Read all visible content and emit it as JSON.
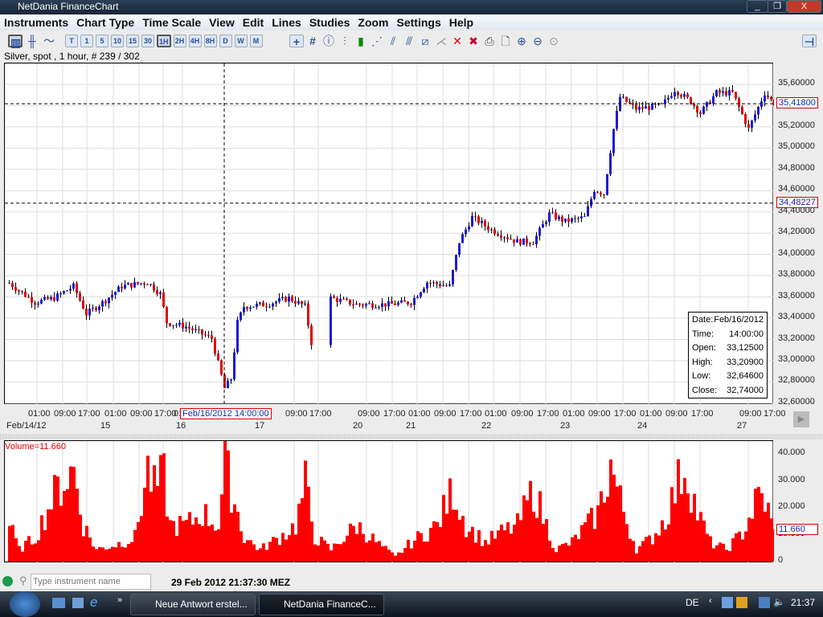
{
  "window": {
    "title": "NetDania FinanceChart",
    "minimize": "_",
    "restore": "❐",
    "close": "X"
  },
  "menu": [
    "Instruments",
    "Chart Type",
    "Time Scale",
    "View",
    "Edit",
    "Lines",
    "Studies",
    "Zoom",
    "Settings",
    "Help"
  ],
  "toolbar": {
    "timeframes": [
      "T",
      "1",
      "5",
      "10",
      "15",
      "30",
      "1H",
      "2H",
      "4H",
      "8H",
      "D",
      "W",
      "M"
    ],
    "selected": "1H"
  },
  "info_line": "Silver, spot , 1 hour, # 239 / 302",
  "colors": {
    "up": "#1a1ad8",
    "down": "#e00000",
    "volume": "#ff0000"
  },
  "chart_data": {
    "type": "candlestick",
    "instrument": "Silver, spot",
    "interval": "1 hour",
    "bars_shown": 239,
    "bars_total": 302,
    "ylim": [
      32.6,
      35.6
    ],
    "y_ticks": [
      "35,60000",
      "35,40000",
      "35,20000",
      "35,00000",
      "34,80000",
      "34,60000",
      "34,40000",
      "34,20000",
      "34,00000",
      "33,80000",
      "33,60000",
      "33,40000",
      "33,20000",
      "33,00000",
      "32,80000",
      "32,60000"
    ],
    "price_path": [
      [
        0,
        33.73
      ],
      [
        8,
        33.55
      ],
      [
        14,
        33.59
      ],
      [
        20,
        33.7
      ],
      [
        24,
        33.44
      ],
      [
        30,
        33.57
      ],
      [
        35,
        33.7
      ],
      [
        43,
        33.74
      ],
      [
        47,
        33.63
      ],
      [
        49,
        33.36
      ],
      [
        55,
        33.32
      ],
      [
        63,
        33.21
      ],
      [
        67,
        32.74
      ],
      [
        69,
        32.83
      ],
      [
        71,
        33.36
      ],
      [
        73,
        33.51
      ],
      [
        80,
        33.53
      ],
      [
        87,
        33.59
      ],
      [
        92,
        33.51
      ],
      [
        94,
        33.17
      ],
      [
        99,
        33.17
      ],
      [
        100,
        33.59
      ],
      [
        108,
        33.53
      ],
      [
        118,
        33.53
      ],
      [
        125,
        33.55
      ],
      [
        130,
        33.74
      ],
      [
        137,
        33.7
      ],
      [
        140,
        34.12
      ],
      [
        144,
        34.35
      ],
      [
        150,
        34.23
      ],
      [
        158,
        34.12
      ],
      [
        163,
        34.12
      ],
      [
        168,
        34.38
      ],
      [
        173,
        34.31
      ],
      [
        179,
        34.35
      ],
      [
        182,
        34.61
      ],
      [
        185,
        34.57
      ],
      [
        188,
        35.18
      ],
      [
        190,
        35.48
      ],
      [
        195,
        35.37
      ],
      [
        203,
        35.4
      ],
      [
        207,
        35.55
      ],
      [
        212,
        35.44
      ],
      [
        215,
        35.33
      ],
      [
        220,
        35.52
      ],
      [
        225,
        35.52
      ],
      [
        230,
        35.18
      ],
      [
        235,
        35.52
      ],
      [
        238,
        35.418
      ]
    ],
    "crosshair_price": "34,48227",
    "last_price": "35,41800",
    "x_hour_labels": [
      "01:00",
      "09:00",
      "17:00",
      "01:00",
      "09:00",
      "17:00",
      "01",
      "09:00",
      "17:00",
      "09:00",
      "17:00",
      "01:00",
      "09:00",
      "17:00",
      "01:00",
      "09:00",
      "17:00",
      "01:00",
      "09:00",
      "17:00",
      "01:00",
      "09:00",
      "17:00",
      "09:00",
      "17:00"
    ],
    "x_date_labels": [
      "Feb/14/12",
      "15",
      "16",
      "17",
      "20",
      "21",
      "22",
      "23",
      "24",
      "27"
    ],
    "crosshair_time": "Feb/16/2012 14:00:00",
    "ohlc_box": {
      "date_label": "Date:",
      "date": "Feb/16/2012",
      "time_label": "Time:",
      "time": "14:00:00",
      "open_label": "Open:",
      "open": "33,12500",
      "high_label": "High:",
      "high": "33,20900",
      "low_label": "Low:",
      "low": "32,64600",
      "close_label": "Close:",
      "close": "32,74000"
    },
    "volume": {
      "label": "Volume=11.660",
      "current": "11.660",
      "ylim": [
        0,
        40000
      ],
      "y_ticks": [
        "40.000",
        "30.000",
        "20.000",
        "10.000",
        "0"
      ],
      "path": [
        [
          0,
          15
        ],
        [
          3,
          5
        ],
        [
          8,
          10
        ],
        [
          13,
          25
        ],
        [
          15,
          30
        ],
        [
          20,
          38
        ],
        [
          23,
          15
        ],
        [
          27,
          5
        ],
        [
          33,
          7
        ],
        [
          39,
          10
        ],
        [
          43,
          38
        ],
        [
          45,
          30
        ],
        [
          48,
          35
        ],
        [
          50,
          15
        ],
        [
          55,
          15
        ],
        [
          60,
          20
        ],
        [
          65,
          15
        ],
        [
          67,
          40
        ],
        [
          70,
          25
        ],
        [
          73,
          10
        ],
        [
          78,
          5
        ],
        [
          84,
          10
        ],
        [
          89,
          15
        ],
        [
          92,
          32
        ],
        [
          95,
          10
        ],
        [
          100,
          5
        ],
        [
          108,
          15
        ],
        [
          115,
          7
        ],
        [
          120,
          2
        ],
        [
          125,
          8
        ],
        [
          133,
          15
        ],
        [
          138,
          30
        ],
        [
          142,
          15
        ],
        [
          148,
          8
        ],
        [
          153,
          12
        ],
        [
          158,
          15
        ],
        [
          163,
          30
        ],
        [
          167,
          15
        ],
        [
          170,
          5
        ],
        [
          175,
          8
        ],
        [
          183,
          20
        ],
        [
          187,
          40
        ],
        [
          190,
          25
        ],
        [
          195,
          5
        ],
        [
          200,
          10
        ],
        [
          204,
          18
        ],
        [
          210,
          40
        ],
        [
          214,
          20
        ],
        [
          218,
          8
        ],
        [
          223,
          5
        ],
        [
          228,
          12
        ],
        [
          233,
          27
        ],
        [
          235,
          25
        ],
        [
          238,
          11.66
        ]
      ]
    }
  },
  "status": {
    "search_placeholder": "Type instrument name",
    "datetime": "29 Feb 2012 21:37:30 MEZ"
  },
  "taskbar": {
    "tasks": [
      "Neue Antwort erstel...",
      "NetDania FinanceC..."
    ],
    "lang": "DE",
    "clock": "21:37",
    "chevron": "»"
  }
}
